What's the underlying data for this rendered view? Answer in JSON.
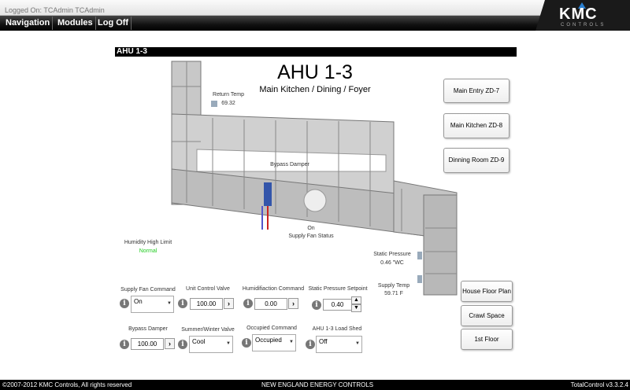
{
  "header": {
    "logged_on": "Logged On: TCAdmin TCAdmin",
    "nav": [
      "Navigation",
      "Modules",
      "Log Off"
    ],
    "logo_text": "KMC",
    "logo_sub": "CONTROLS"
  },
  "page": {
    "titlebar": "AHU 1-3",
    "title": "AHU 1-3",
    "subtitle": "Main Kitchen / Dining / Foyer"
  },
  "diagram": {
    "return_temp_label": "Return Temp",
    "return_temp_value": "69.32",
    "bypass_label": "Bypass Damper",
    "fan_status_value": "On",
    "fan_status_label": "Supply Fan Status",
    "humidity_label": "Humidity High Limit",
    "humidity_value": "Normal",
    "humidity_color": "#22cc22",
    "static_label": "Static Pressure",
    "static_value": "0.46 \"WC",
    "supply_temp_label": "Supply Temp",
    "supply_temp_value": "59.71 F"
  },
  "zone_buttons": [
    "Main Entry ZD-7",
    "Main Kitchen ZD-8",
    "Dinning Room ZD-9"
  ],
  "nav_buttons": [
    "House Floor Plan",
    "Crawl Space",
    "1st Floor"
  ],
  "controls": {
    "supply_fan": {
      "label": "Supply Fan Command",
      "value": "On"
    },
    "unit_valve": {
      "label": "Unit Control Valve",
      "value": "100.00"
    },
    "humidification": {
      "label": "Humidifiaction Command",
      "value": "0.00"
    },
    "static_sp": {
      "label": "Static Pressure Setpoint",
      "value": "0.40"
    },
    "bypass": {
      "label": "Bypass Damper",
      "value": "100.00"
    },
    "summer_winter": {
      "label": "Summer/Winter Valve",
      "value": "Cool"
    },
    "occupied": {
      "label": "Occupied Command",
      "value": "Occupied"
    },
    "load_shed": {
      "label": "AHU 1-3 Load Shed",
      "value": "Off"
    }
  },
  "footer": {
    "left": "©2007-2012 KMC Controls, All rights reserved",
    "center": "NEW ENGLAND ENERGY CONTROLS",
    "right": "TotalControl v3.3.2.4"
  }
}
